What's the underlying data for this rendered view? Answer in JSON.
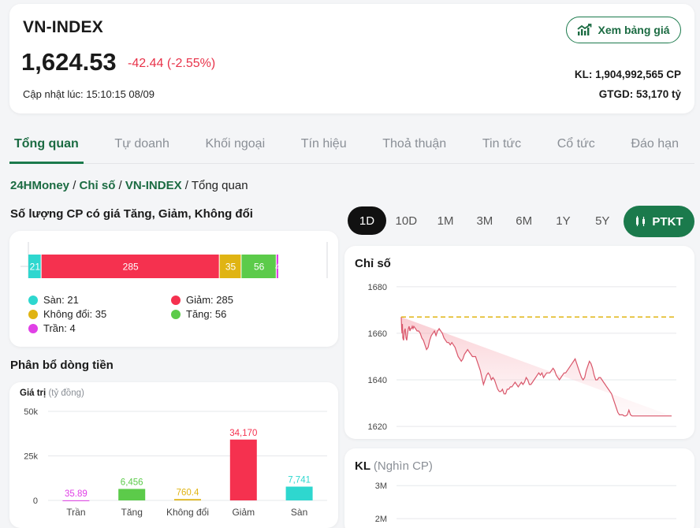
{
  "header": {
    "index_name": "VN-INDEX",
    "value": "1,624.53",
    "change": "-42.44 (-2.55%)",
    "updated": "Cập nhật lúc: 15:10:15 08/09",
    "price_board_label": "Xem bảng giá",
    "kl": "KL: 1,904,992,565 CP",
    "gtgd": "GTGD: 53,170 tỷ"
  },
  "tabs": [
    {
      "label": "Tổng quan",
      "active": true
    },
    {
      "label": "Tự doanh"
    },
    {
      "label": "Khối ngoại"
    },
    {
      "label": "Tín hiệu"
    },
    {
      "label": "Thoả thuận"
    },
    {
      "label": "Tin tức"
    },
    {
      "label": "Cổ tức"
    },
    {
      "label": "Đáo hạn"
    }
  ],
  "breadcrumb": {
    "home": "24HMoney",
    "sep1": " / ",
    "category": "Chỉ số",
    "sep2": " / ",
    "index": "VN-INDEX",
    "sep3": " / ",
    "current": "Tổng quan"
  },
  "count_section": {
    "title": "Số lượng CP có giá Tăng, Giảm, Không đổi",
    "segments": [
      {
        "key": "san",
        "value": 21,
        "label": "21",
        "color": "#2ed7cf"
      },
      {
        "key": "giam",
        "value": 285,
        "label": "285",
        "color": "#f5314f"
      },
      {
        "key": "khong_doi",
        "value": 35,
        "label": "35",
        "color": "#e0b413"
      },
      {
        "key": "tang",
        "value": 56,
        "label": "56",
        "color": "#5ccb4a"
      },
      {
        "key": "tran",
        "value": 4,
        "label": "4",
        "color": "#e040e6"
      }
    ],
    "legend": {
      "san": "Sàn: 21",
      "giam": "Giảm: 285",
      "khong_doi": "Không đổi: 35",
      "tang": "Tăng: 56",
      "tran": "Trần: 4"
    }
  },
  "flow_section": {
    "title": "Phân bổ dòng tiền",
    "axis_title": "Giá trị",
    "axis_unit": "(tỷ đồng)"
  },
  "periods": [
    {
      "label": "1D",
      "active": true
    },
    {
      "label": "10D"
    },
    {
      "label": "1M"
    },
    {
      "label": "3M"
    },
    {
      "label": "6M"
    },
    {
      "label": "1Y"
    },
    {
      "label": "5Y"
    }
  ],
  "ptkt_label": "PTKT",
  "index_chart_title": "Chỉ số",
  "kl_chart": {
    "title": "KL",
    "unit": "(Nghìn CP)"
  },
  "colors": {
    "brand_green": "#1b7a4c",
    "down_red": "#e8334a",
    "reference_line": "#e0b413"
  },
  "chart_data": [
    {
      "type": "bar",
      "title": "Phân bổ dòng tiền",
      "ylabel": "Giá trị (tỷ đồng)",
      "categories": [
        "Trần",
        "Tăng",
        "Không đổi",
        "Giảm",
        "Sàn"
      ],
      "values": [
        35.89,
        6456,
        760.4,
        34170,
        7741
      ],
      "value_labels": [
        "35.89",
        "6,456",
        "760.4",
        "34,170",
        "7,741"
      ],
      "colors": [
        "#e040e6",
        "#5ccb4a",
        "#e0b413",
        "#f5314f",
        "#2ed7cf"
      ],
      "ylim": [
        0,
        50000
      ],
      "yticks": [
        0,
        25000,
        50000
      ],
      "ytick_labels": [
        "0",
        "25k",
        "50k"
      ],
      "grid": true
    },
    {
      "type": "area",
      "title": "Chỉ số",
      "ylim": [
        1617,
        1684
      ],
      "yticks": [
        1620,
        1640,
        1660,
        1680
      ],
      "reference": 1667,
      "x": [
        0,
        0.5,
        1,
        1.5,
        2,
        3,
        4,
        5,
        6,
        7,
        8,
        9,
        10,
        11,
        12,
        13,
        14,
        15,
        16,
        18,
        20,
        22,
        24,
        26,
        28,
        30,
        32,
        34,
        36,
        38,
        40,
        42,
        44,
        46,
        48,
        50,
        52,
        54,
        56,
        58,
        60,
        62,
        64,
        66,
        68,
        70,
        72,
        74,
        76,
        78,
        80,
        82,
        84,
        86,
        88,
        90,
        92,
        94,
        96,
        98,
        100,
        102,
        104,
        106,
        108,
        110,
        112,
        114,
        116,
        118,
        120,
        122,
        124,
        126,
        128,
        130,
        132,
        134,
        136,
        138,
        140,
        142,
        144,
        146,
        148,
        150,
        152,
        154,
        156,
        158,
        160,
        162,
        164,
        166,
        168,
        170,
        172,
        174,
        176,
        178,
        180,
        182,
        184,
        186,
        188,
        190,
        192,
        194,
        196,
        198,
        200,
        202,
        204,
        206,
        208,
        210,
        212,
        214,
        216,
        218,
        220,
        222,
        224,
        226,
        228,
        230,
        232,
        234,
        236,
        238,
        240,
        242,
        244,
        246,
        248,
        250,
        252,
        254,
        256,
        258,
        260,
        262,
        264,
        266,
        268,
        270,
        272,
        274,
        276,
        278,
        280,
        282,
        284,
        286,
        288,
        290,
        292,
        294,
        296,
        298,
        300,
        302,
        304,
        306,
        308,
        310,
        312,
        314,
        316,
        318,
        320,
        322,
        324,
        326,
        328,
        330,
        332,
        334,
        336,
        338,
        340,
        342,
        344,
        346,
        348
      ],
      "values": [
        1667,
        1662,
        1660,
        1664,
        1658,
        1657,
        1661,
        1662,
        1658,
        1657,
        1660,
        1662,
        1663,
        1661,
        1662,
        1662,
        1663,
        1662,
        1663,
        1662,
        1661,
        1661,
        1660,
        1658,
        1657,
        1655,
        1653,
        1654,
        1657,
        1659,
        1660,
        1661,
        1659,
        1661,
        1662,
        1661,
        1660,
        1658,
        1657,
        1656,
        1656,
        1655,
        1656,
        1655,
        1654,
        1652,
        1650,
        1649,
        1648,
        1649,
        1651,
        1652,
        1653,
        1652,
        1651,
        1650,
        1650,
        1650,
        1648,
        1646,
        1644,
        1641,
        1638,
        1640,
        1642,
        1643,
        1642,
        1640,
        1641,
        1640,
        1638,
        1636,
        1635,
        1635,
        1636,
        1634,
        1634,
        1636,
        1636,
        1637,
        1637,
        1638,
        1639,
        1638,
        1637,
        1638,
        1639,
        1638,
        1639,
        1641,
        1640,
        1638,
        1638,
        1639,
        1640,
        1641,
        1642,
        1643,
        1642,
        1643,
        1641,
        1642,
        1643,
        1643,
        1643,
        1644,
        1645,
        1644,
        1642,
        1641,
        1640,
        1641,
        1642,
        1643,
        1643,
        1644,
        1645,
        1646,
        1647,
        1648,
        1649,
        1647,
        1645,
        1643,
        1641,
        1640,
        1641,
        1644,
        1646,
        1648,
        1647,
        1645,
        1642,
        1640,
        1640,
        1641,
        1641,
        1640,
        1639,
        1638,
        1637,
        1636,
        1635,
        1634,
        1632,
        1630,
        1628,
        1626,
        1625,
        1625,
        1625,
        1624.5,
        1624.5,
        1625,
        1627,
        1625,
        1624.5,
        1624.5,
        1624.5,
        1624.5,
        1624.5,
        1624.5,
        1624.5,
        1624.5,
        1624.5,
        1624.5,
        1624.5,
        1624.5,
        1624.5,
        1624.5,
        1624.5,
        1624.5,
        1624.5,
        1624.5,
        1624.5,
        1624.5,
        1624.5,
        1624.5,
        1624.5,
        1624.5,
        1624.5,
        1624.5
      ]
    },
    {
      "type": "bar",
      "title": "KL (Nghìn CP)",
      "ylim": [
        1500000,
        3500000
      ],
      "yticks": [
        2000000,
        3000000
      ],
      "ytick_labels": [
        "2M",
        "3M"
      ]
    }
  ]
}
